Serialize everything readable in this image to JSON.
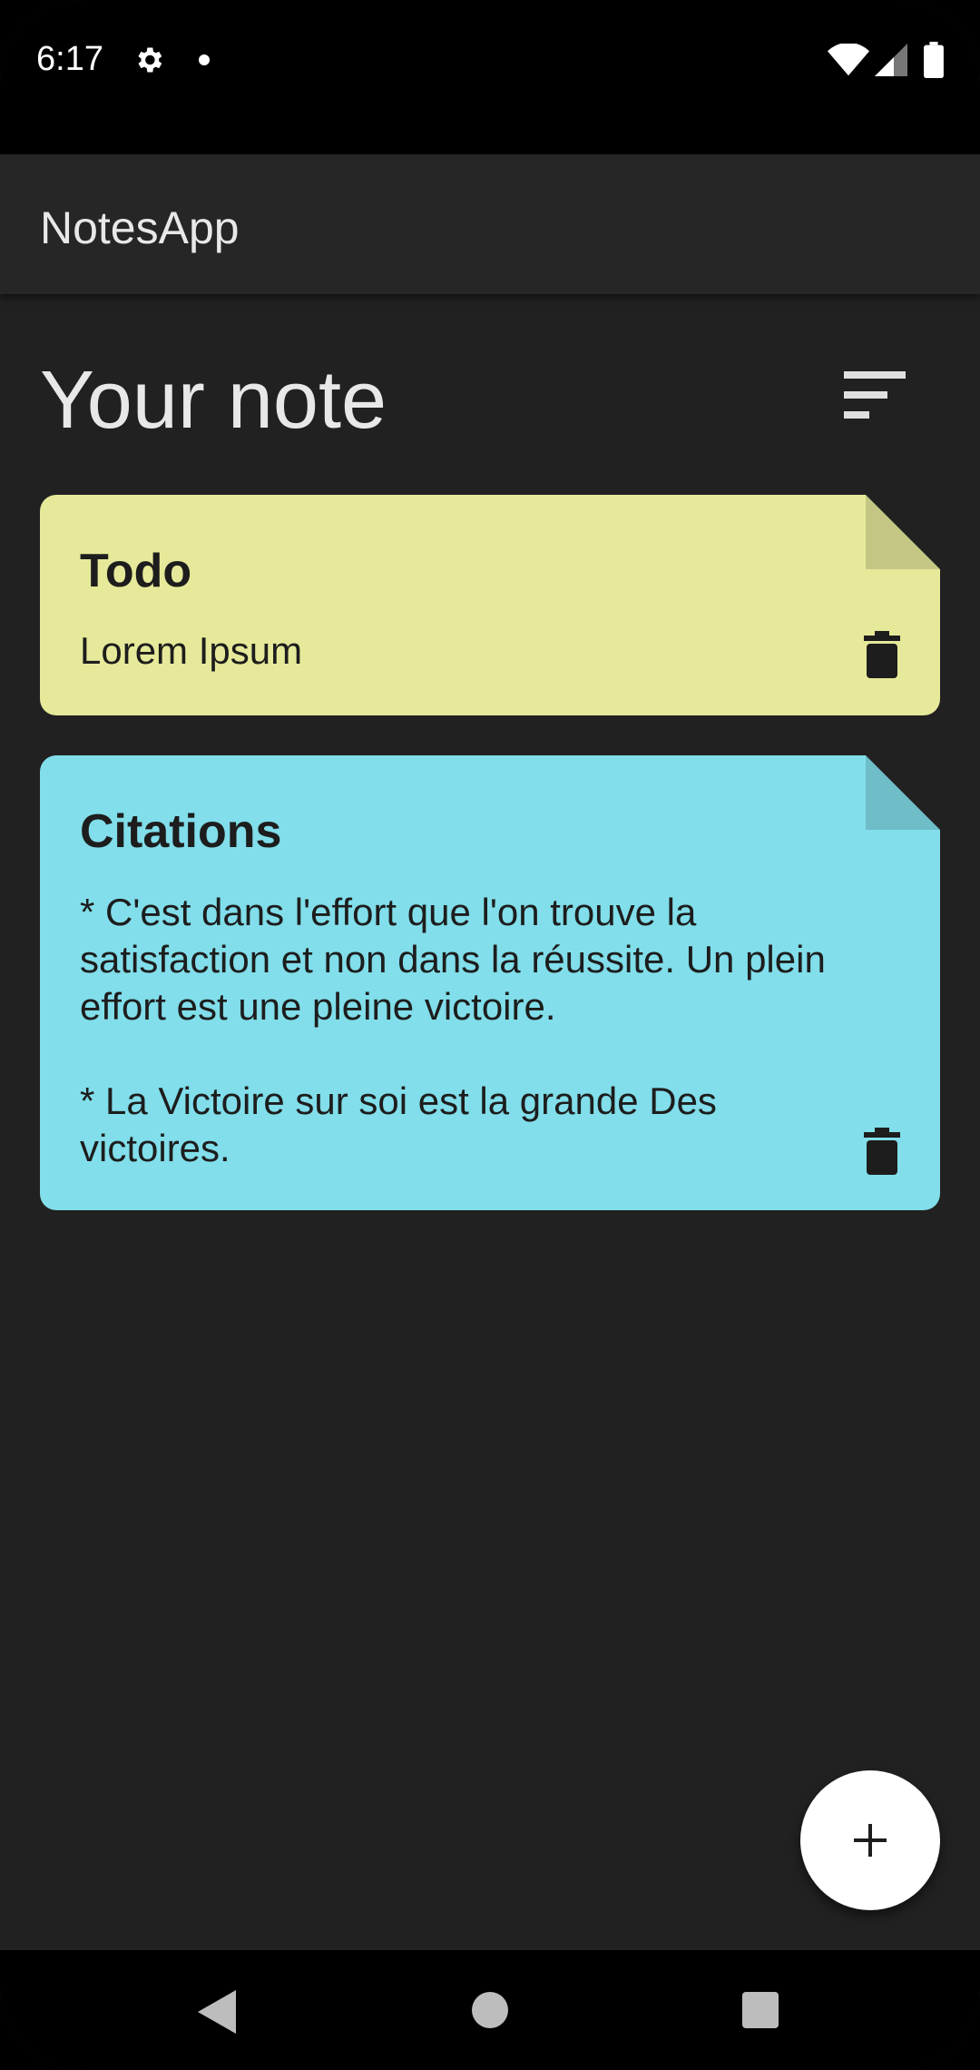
{
  "status_bar": {
    "time": "6:17",
    "icons": [
      "gear-icon",
      "notification-dot",
      "wifi-icon",
      "signal-icon",
      "battery-icon"
    ]
  },
  "app_bar": {
    "title": "NotesApp"
  },
  "header": {
    "title": "Your note",
    "sort_icon": "sort-icon"
  },
  "notes": [
    {
      "title": "Todo",
      "content": "Lorem Ipsum",
      "color": "#e6e999",
      "fold_color": "#c4c784"
    },
    {
      "title": "Citations",
      "content": "* C'est dans l'effort que l'on trouve la satisfaction et non dans la réussite. Un plein effort est une pleine victoire.\n\n* La Victoire sur soi est la grande Des victoires.",
      "color": "#81deea",
      "fold_color": "#6ebdc8"
    }
  ],
  "fab": {
    "icon": "plus-icon"
  },
  "nav_bar": {
    "icons": [
      "back-icon",
      "home-icon",
      "recents-icon"
    ]
  }
}
